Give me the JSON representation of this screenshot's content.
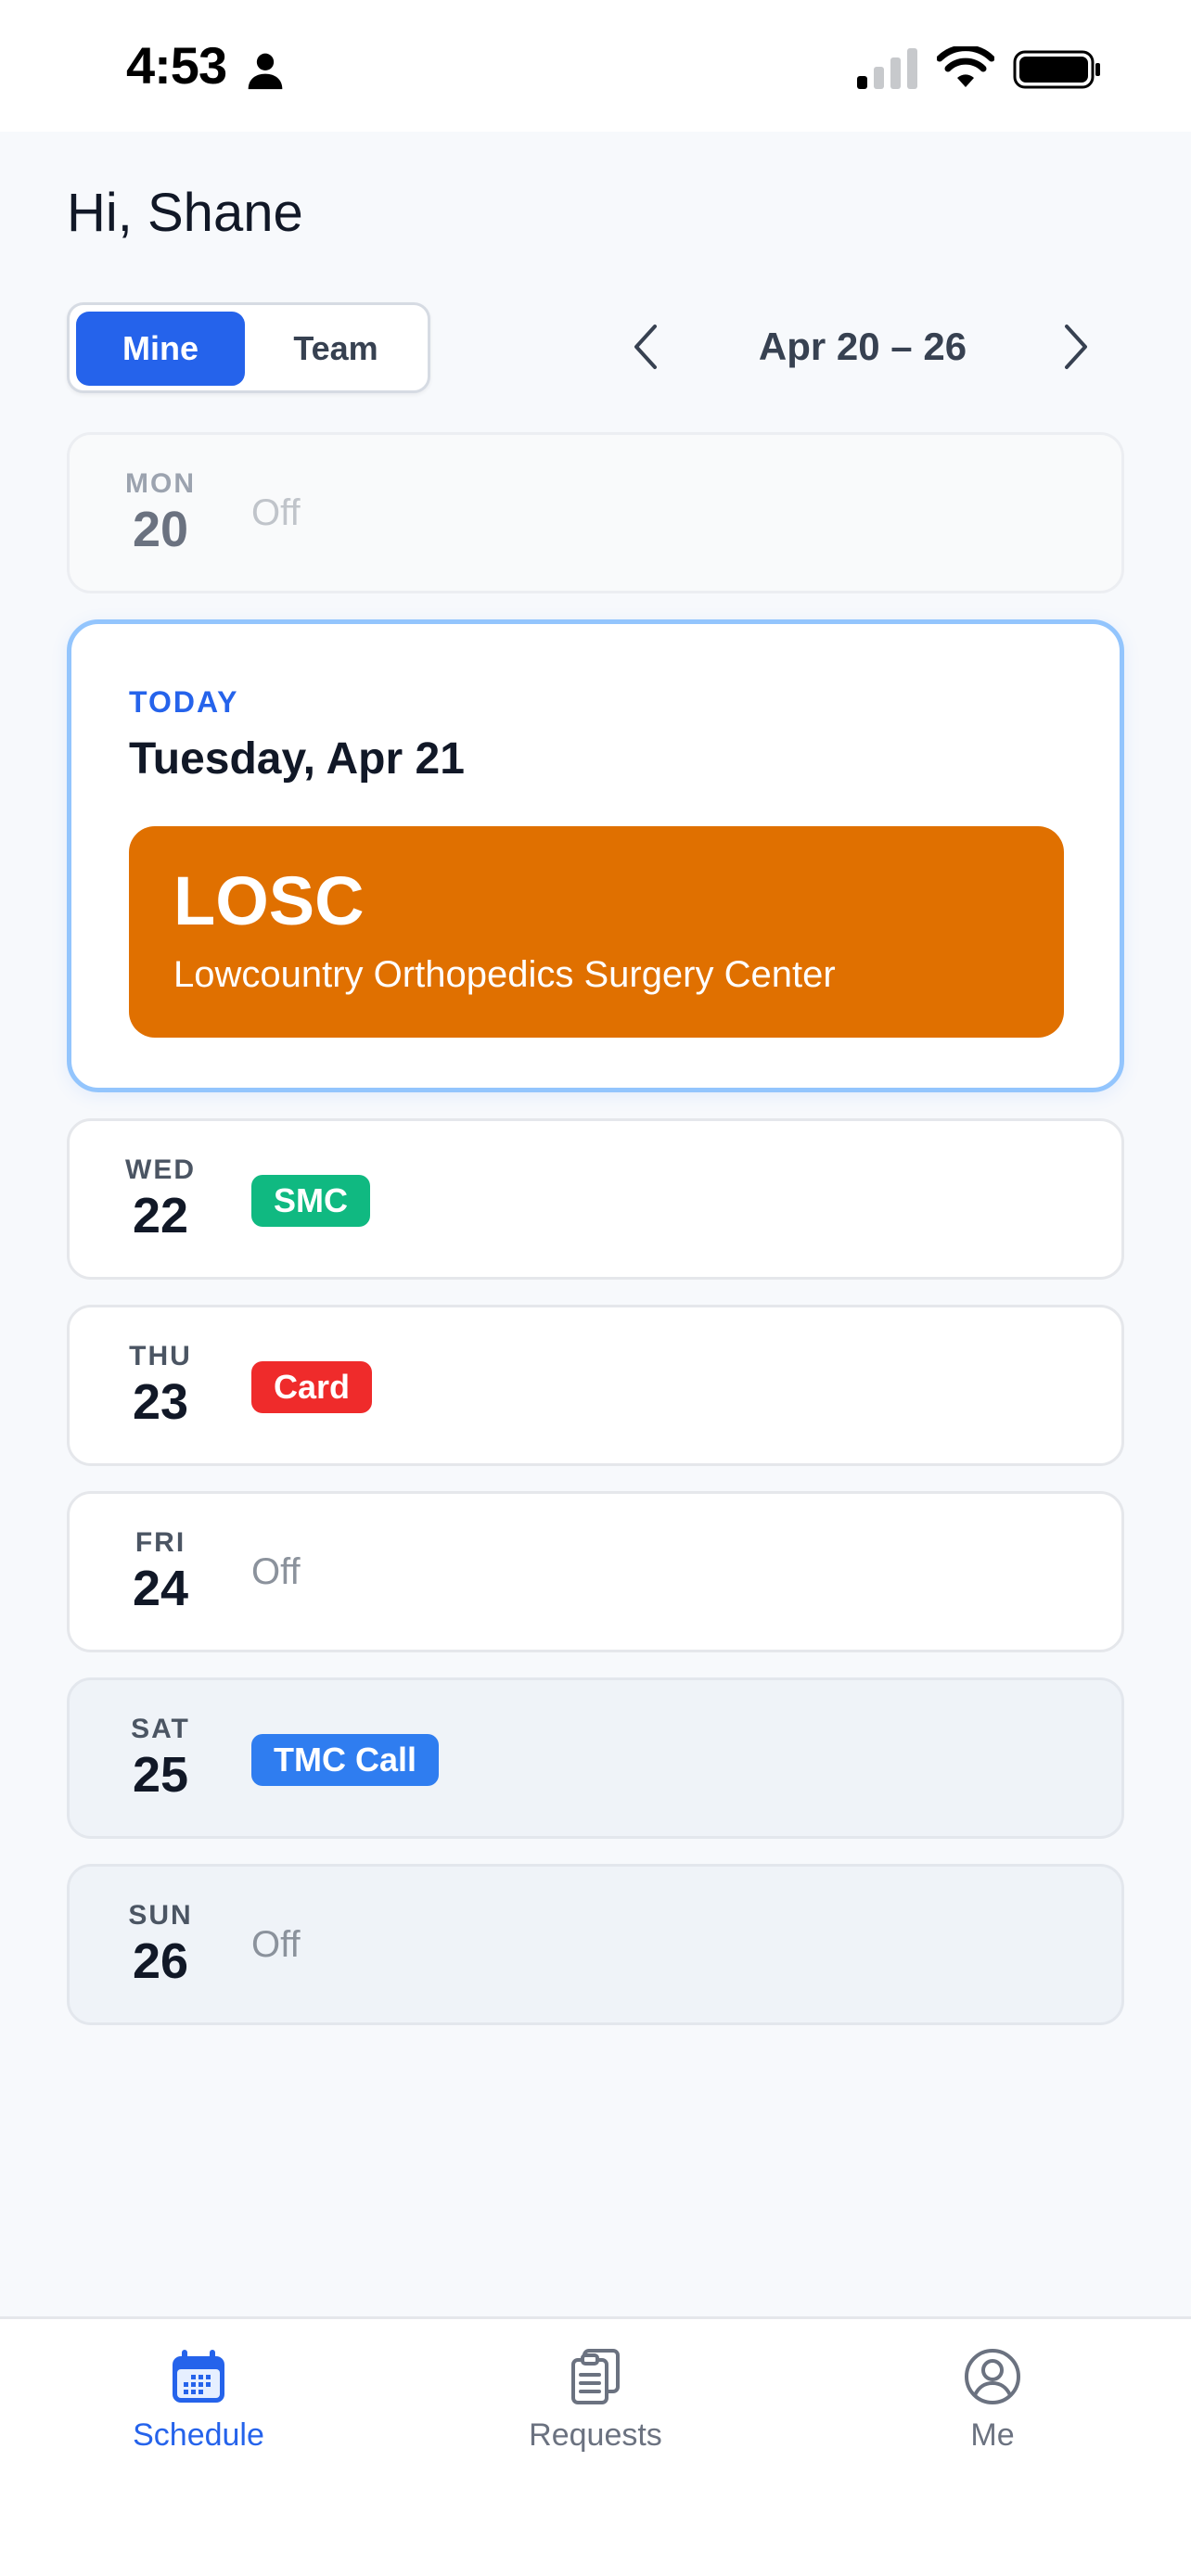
{
  "status_bar": {
    "time": "4:53",
    "icons": [
      "person-icon",
      "signal-icon",
      "wifi-icon",
      "battery-icon"
    ]
  },
  "header": {
    "greeting": "Hi, Shane"
  },
  "toggle": {
    "options": [
      "Mine",
      "Team"
    ],
    "selected": "Mine"
  },
  "week_nav": {
    "label": "Apr 20 – 26",
    "prev_icon": "chevron-left-icon",
    "next_icon": "chevron-right-icon"
  },
  "days": {
    "mon": {
      "name": "MON",
      "num": "20",
      "status": "Off"
    },
    "wed": {
      "name": "WED",
      "num": "22",
      "badge": "SMC",
      "badge_color": "#10b981"
    },
    "thu": {
      "name": "THU",
      "num": "23",
      "badge": "Card",
      "badge_color": "#ef2b2b"
    },
    "fri": {
      "name": "FRI",
      "num": "24",
      "status": "Off"
    },
    "sat": {
      "name": "SAT",
      "num": "25",
      "badge": "TMC Call",
      "badge_color": "#2f7df0"
    },
    "sun": {
      "name": "SUN",
      "num": "26",
      "status": "Off"
    }
  },
  "today": {
    "label": "TODAY",
    "date": "Tuesday, Apr 21",
    "shift_code": "LOSC",
    "shift_name": "Lowcountry Orthopedics Surgery Center",
    "shift_color": "#e07000"
  },
  "tabs": [
    {
      "label": "Schedule",
      "icon": "calendar-icon",
      "active": true
    },
    {
      "label": "Requests",
      "icon": "clipboard-icon",
      "active": false
    },
    {
      "label": "Me",
      "icon": "user-circle-icon",
      "active": false
    }
  ],
  "colors": {
    "accent": "#2563eb",
    "today_border": "#93c5fd"
  }
}
